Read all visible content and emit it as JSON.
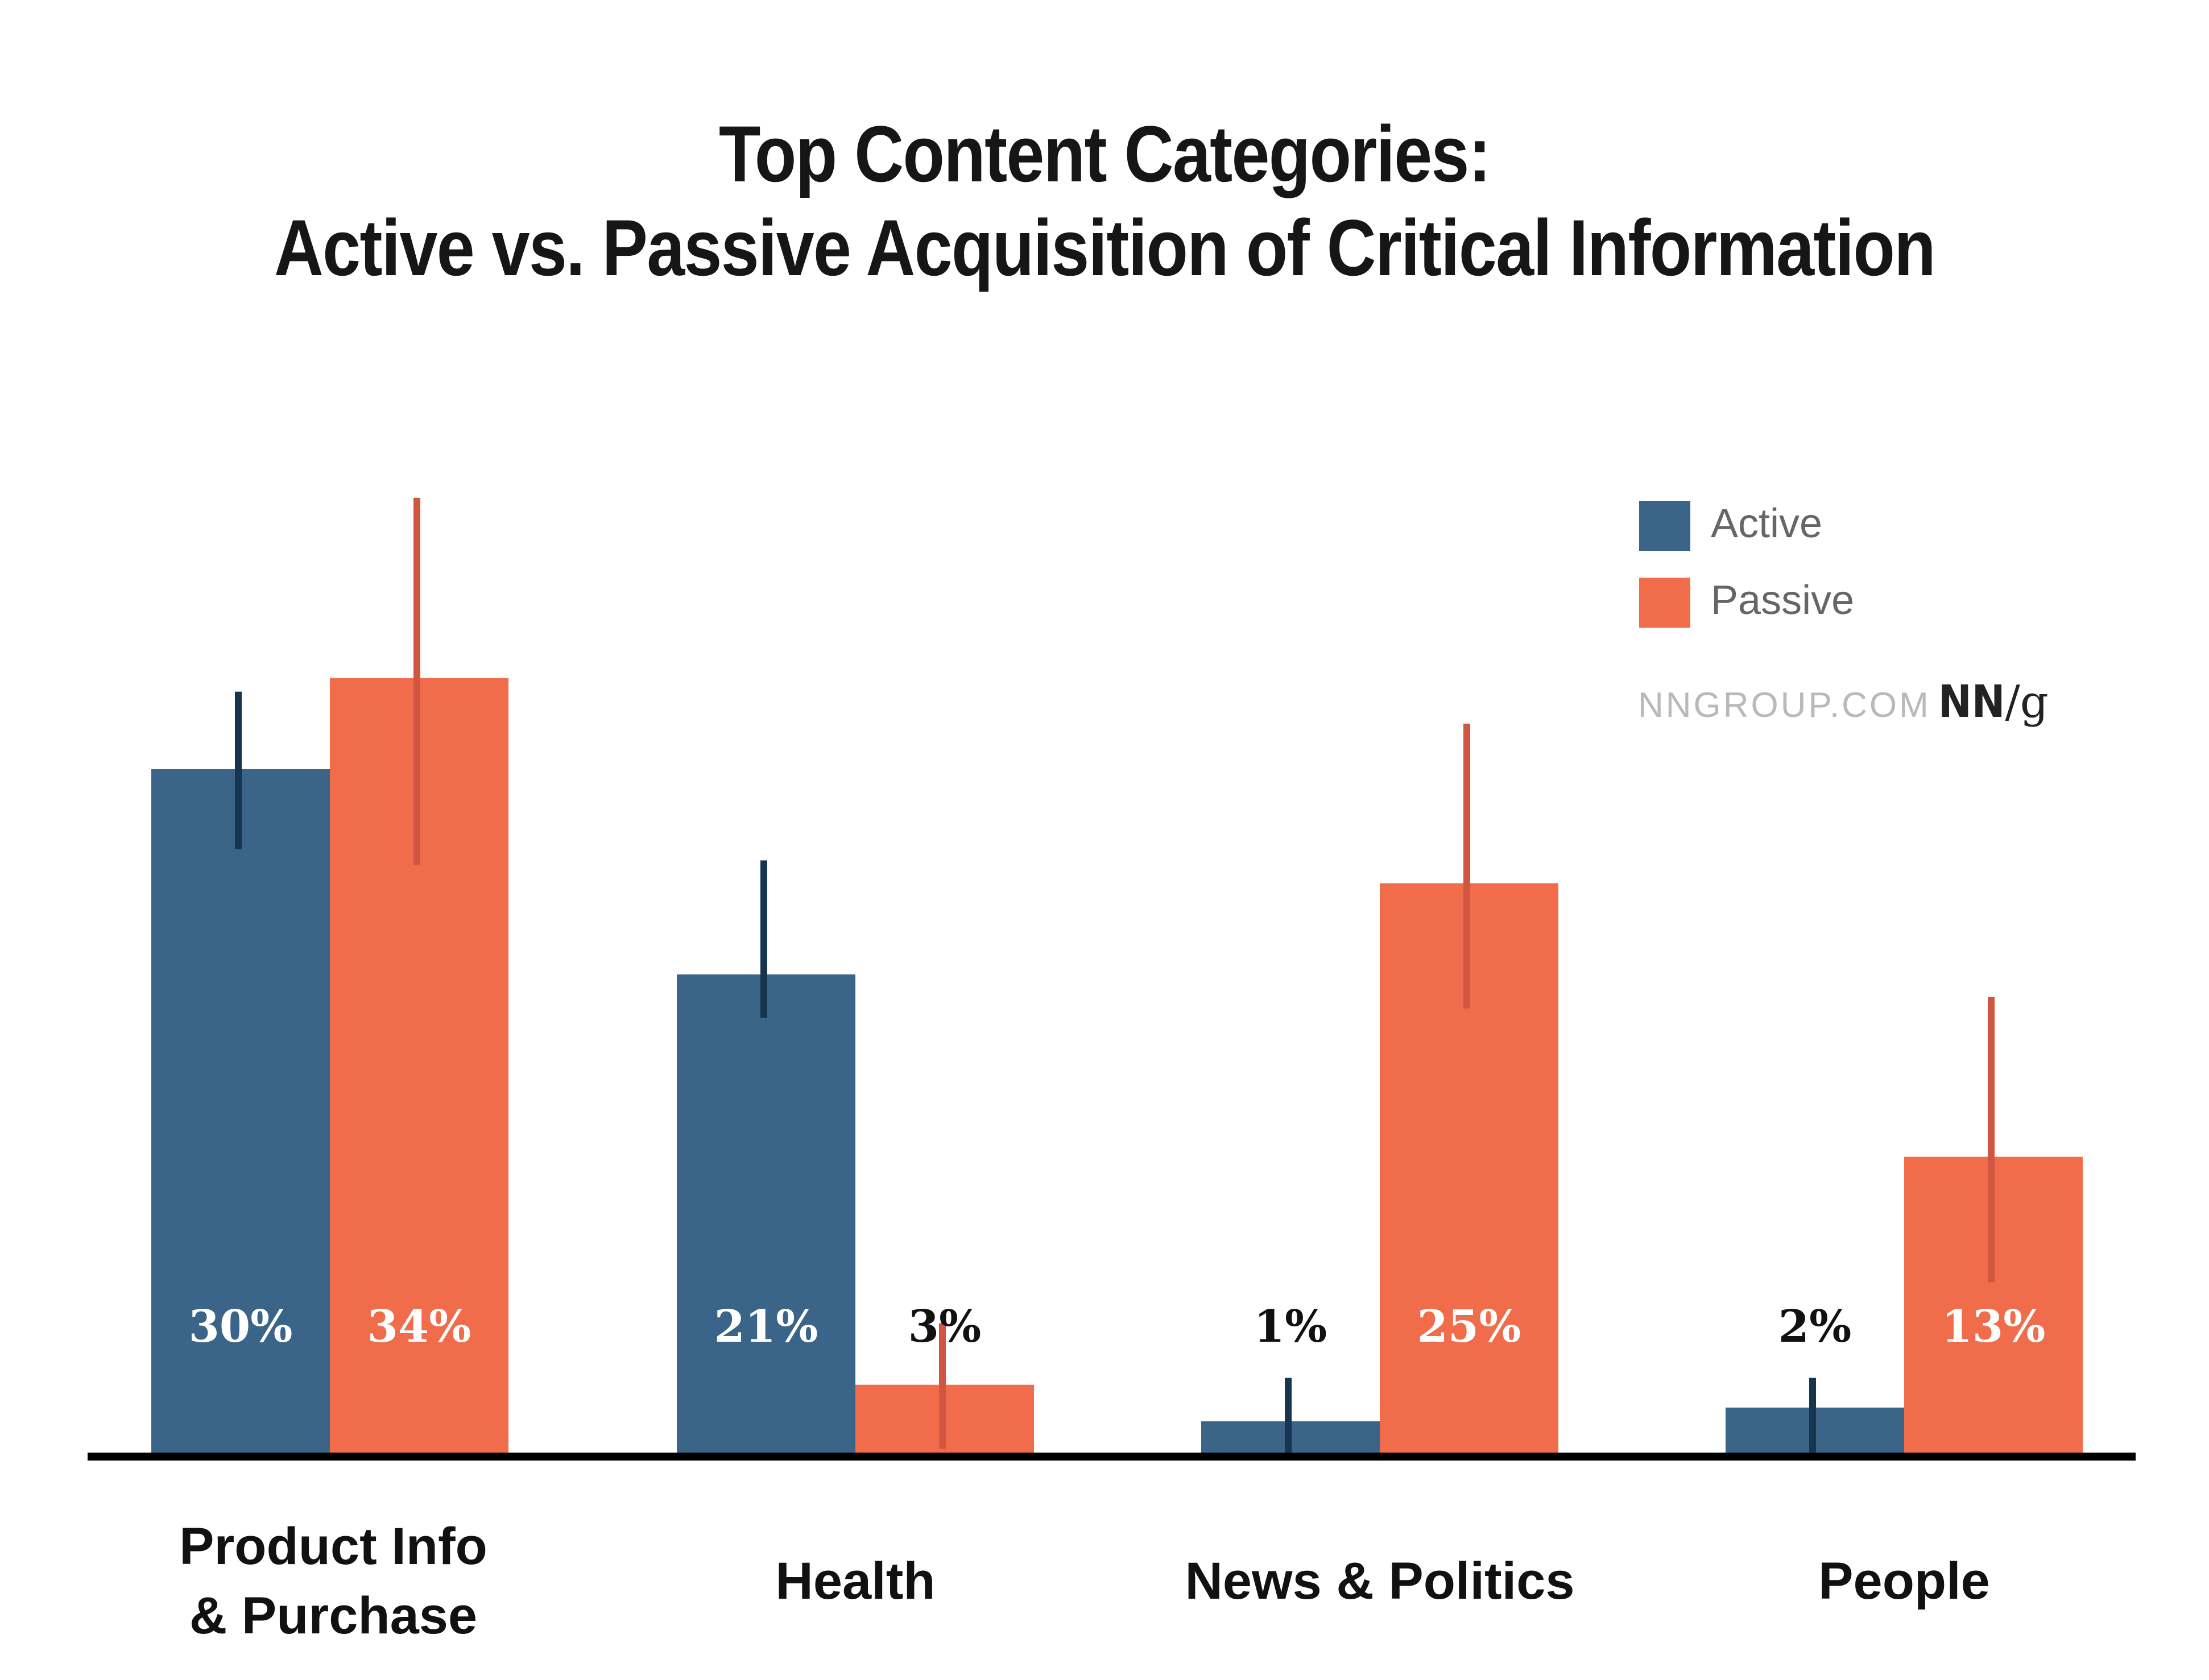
{
  "chart_data": {
    "type": "bar",
    "title": "Top Content Categories:",
    "subtitle": "Active vs. Passive Acquisition of Critical Information",
    "xlabel": "",
    "ylabel": "",
    "ylim": [
      0,
      44
    ],
    "grid": false,
    "legend_position": "top-right",
    "categories": [
      [
        "Product Info",
        "& Purchase"
      ],
      [
        "Health"
      ],
      [
        "News & Politics"
      ],
      [
        "People"
      ]
    ],
    "series": [
      {
        "name": "Active",
        "color": "#3a6488",
        "error_color": "#17354f",
        "values": [
          30,
          21,
          1,
          2
        ],
        "labels": [
          "30%",
          "21%",
          "1%",
          "2%"
        ],
        "error_bars": [
          [
            26.5,
            33.4
          ],
          [
            19.1,
            26.0
          ],
          [
            -0.3,
            3.3
          ],
          [
            -0.3,
            3.3
          ]
        ]
      },
      {
        "name": "Passive",
        "color": "#f06c4b",
        "error_color": "#d05640",
        "values": [
          34,
          3,
          25,
          13
        ],
        "labels": [
          "34%",
          "3%",
          "25%",
          "13%"
        ],
        "error_bars": [
          [
            25.8,
            41.9
          ],
          [
            0.2,
            5.7
          ],
          [
            19.5,
            32.0
          ],
          [
            7.5,
            20.0
          ]
        ]
      }
    ],
    "label_colors": {
      "inside": "#ffffff",
      "outside": "#111111"
    },
    "axis_color": "#000000"
  },
  "legend": {
    "items": [
      {
        "label": "Active",
        "color": "#3a6488"
      },
      {
        "label": "Passive",
        "color": "#f06c4b"
      }
    ]
  },
  "branding": {
    "url": "NNGROUP.COM",
    "logo_main": "NN",
    "logo_slash": "/",
    "logo_tail": "g"
  }
}
